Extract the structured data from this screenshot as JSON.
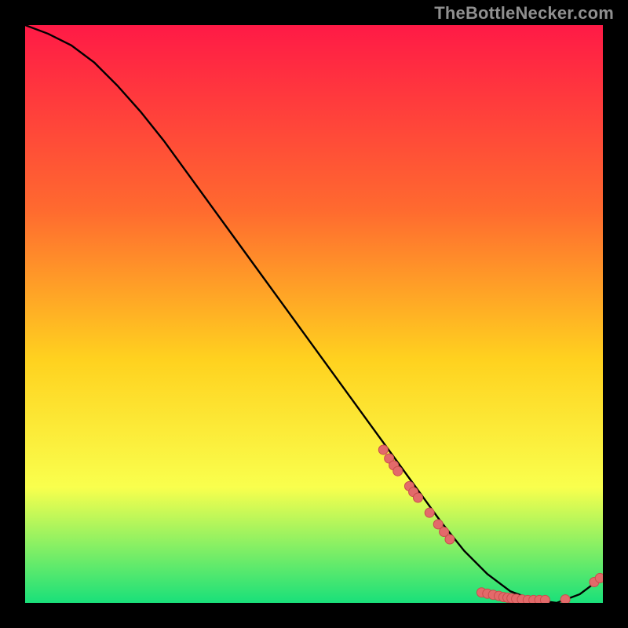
{
  "watermark": "TheBottleNecker.com",
  "colors": {
    "gradient_top": "#ff1a46",
    "gradient_mid1": "#ff6a2f",
    "gradient_mid2": "#ffd21f",
    "gradient_mid3": "#f9ff4d",
    "gradient_bottom": "#19e07a",
    "curve": "#000000",
    "dot_fill": "#e36a6a",
    "dot_stroke": "#c94d4d"
  },
  "chart_data": {
    "type": "line",
    "title": "",
    "xlabel": "",
    "ylabel": "",
    "xlim": [
      0,
      100
    ],
    "ylim": [
      0,
      100
    ],
    "curve": {
      "x": [
        0,
        4,
        8,
        12,
        16,
        20,
        24,
        28,
        32,
        36,
        40,
        44,
        48,
        52,
        56,
        60,
        64,
        68,
        72,
        76,
        80,
        84,
        88,
        92,
        96,
        100
      ],
      "y": [
        100,
        98.5,
        96.5,
        93.5,
        89.5,
        85.0,
        80.0,
        74.5,
        69.0,
        63.5,
        58.0,
        52.5,
        47.0,
        41.5,
        36.0,
        30.5,
        25.0,
        19.5,
        14.0,
        9.0,
        5.0,
        2.0,
        0.5,
        0.0,
        1.5,
        4.5
      ]
    },
    "dot_clusters": [
      {
        "comment": "diagonal falling segment of dots",
        "points": [
          [
            62.0,
            26.5
          ],
          [
            63.0,
            25.0
          ],
          [
            63.8,
            23.8
          ],
          [
            64.5,
            22.8
          ],
          [
            66.5,
            20.2
          ],
          [
            67.2,
            19.2
          ],
          [
            68.0,
            18.2
          ],
          [
            70.0,
            15.6
          ],
          [
            71.5,
            13.6
          ],
          [
            72.5,
            12.3
          ],
          [
            73.5,
            11.0
          ]
        ]
      },
      {
        "comment": "bottom near-zero run",
        "points": [
          [
            79.0,
            1.8
          ],
          [
            80.0,
            1.6
          ],
          [
            81.0,
            1.4
          ],
          [
            82.0,
            1.2
          ],
          [
            82.8,
            1.0
          ],
          [
            83.5,
            0.9
          ],
          [
            84.2,
            0.8
          ],
          [
            85.0,
            0.7
          ],
          [
            86.0,
            0.6
          ],
          [
            87.0,
            0.5
          ],
          [
            88.0,
            0.5
          ],
          [
            89.0,
            0.5
          ],
          [
            90.0,
            0.5
          ],
          [
            93.5,
            0.6
          ]
        ]
      },
      {
        "comment": "rising tail on the right",
        "points": [
          [
            98.5,
            3.6
          ],
          [
            99.5,
            4.3
          ]
        ]
      }
    ]
  }
}
